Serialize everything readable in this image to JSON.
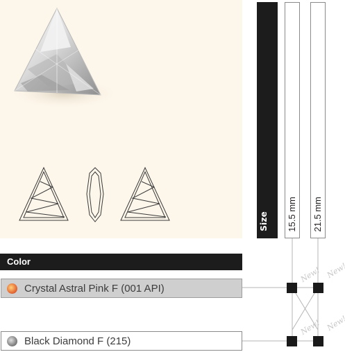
{
  "size_header": {
    "label": "Size"
  },
  "sizes": [
    {
      "label": "15.5 mm"
    },
    {
      "label": "21.5 mm"
    }
  ],
  "color_header": {
    "label": "Color"
  },
  "colors": [
    {
      "name": "Crystal Astral Pink F (001 API)",
      "swatch_color": "#e8743c",
      "availability": [
        true,
        true
      ]
    },
    {
      "name": "Black Diamond F (215)",
      "swatch_color": "#8c8c8c",
      "availability": [
        true,
        true
      ]
    }
  ],
  "new_badge": "New!",
  "palette": {
    "panel": "#fdf6ea",
    "header": "#1c1c1c",
    "row_highlight": "#cfcfcf",
    "marker": "#1a1a1a"
  },
  "icons": [
    "triangle-crystal-photo",
    "triangle-front-outline-icon",
    "triangle-side-outline-icon",
    "triangle-back-outline-icon"
  ]
}
